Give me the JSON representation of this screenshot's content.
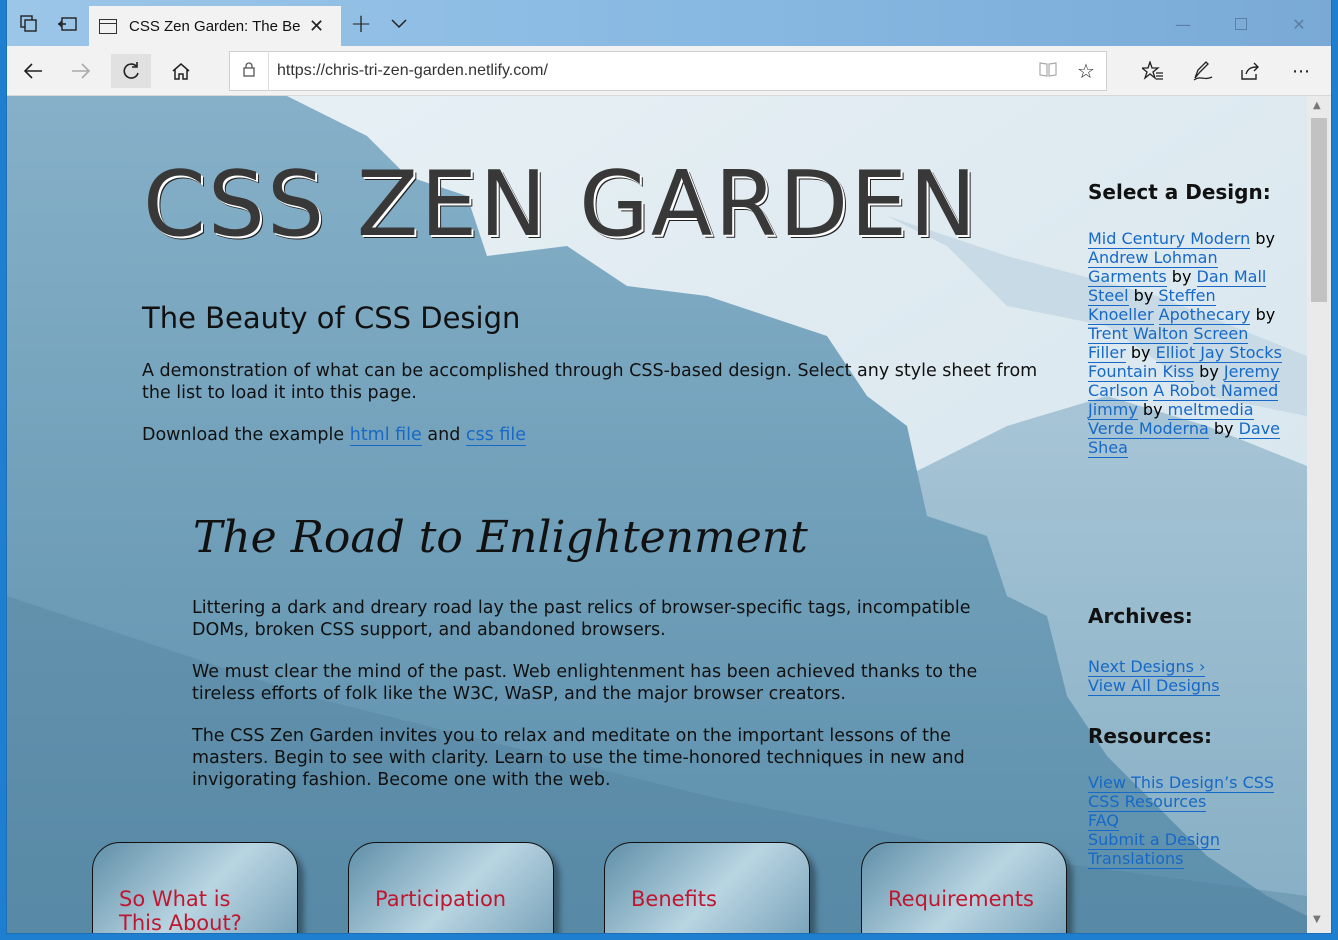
{
  "browser": {
    "tab_title": "CSS Zen Garden: The Be",
    "url": "https://chris-tri-zen-garden.netlify.com/"
  },
  "page": {
    "title": "CSS ZEN GARDEN",
    "subtitle": "The Beauty of CSS Design",
    "intro": "A demonstration of what can be accomplished through CSS-based design. Select any style sheet from the list to load it into this page.",
    "download_prefix": "Download the example",
    "html_link": "html file",
    "and_text": "and",
    "css_link": "css file",
    "road_title": "The Road to Enlightenment",
    "road_p1": "Littering a dark and dreary road lay the past relics of browser-specific tags, incompatible DOMs, broken CSS support, and abandoned browsers.",
    "road_p2": "We must clear the mind of the past. Web enlightenment has been achieved thanks to the tireless efforts of folk like the W3C, WaSP, and the major browser creators.",
    "road_p3": "The CSS Zen Garden invites you to relax and meditate on the important lessons of the masters. Begin to see with clarity. Learn to use the time-honored techniques in new and invigorating fashion. Become one with the web."
  },
  "sidebar": {
    "select_heading": "Select a Design:",
    "by": "by",
    "designs": [
      {
        "name": "Mid Century Modern",
        "author": "Andrew Lohman"
      },
      {
        "name": "Garments",
        "author": "Dan Mall"
      },
      {
        "name": "Steel",
        "author": "Steffen Knoeller"
      },
      {
        "name": "Apothecary",
        "author": "Trent Walton"
      },
      {
        "name": "Screen Filler",
        "author": "Elliot Jay Stocks"
      },
      {
        "name": "Fountain Kiss",
        "author": "Jeremy Carlson"
      },
      {
        "name": "A Robot Named Jimmy",
        "author": "meltmedia"
      },
      {
        "name": "Verde Moderna",
        "author": "Dave Shea"
      }
    ],
    "archives_heading": "Archives:",
    "next_designs": "Next Designs ›",
    "view_all": "View All Designs",
    "resources_heading": "Resources:",
    "resources": [
      "View This Design’s CSS",
      "CSS Resources",
      "FAQ",
      "Submit a Design",
      "Translations"
    ]
  },
  "cards": [
    "So What is This About?",
    "Participation",
    "Benefits",
    "Requirements"
  ],
  "colors": {
    "link": "#1769c7",
    "card_title": "#c01730",
    "window_border": "#1e7fd0"
  },
  "icons": [
    "tab-actions-icon",
    "set-aside-tabs-icon",
    "tab-page-icon",
    "close-icon",
    "new-tab-icon",
    "chevron-down-icon",
    "minimize-icon",
    "maximize-icon",
    "back-icon",
    "forward-icon",
    "refresh-icon",
    "home-icon",
    "lock-icon",
    "reading-view-icon",
    "star-icon",
    "favorites-icon",
    "pen-icon",
    "share-icon",
    "more-icon"
  ]
}
